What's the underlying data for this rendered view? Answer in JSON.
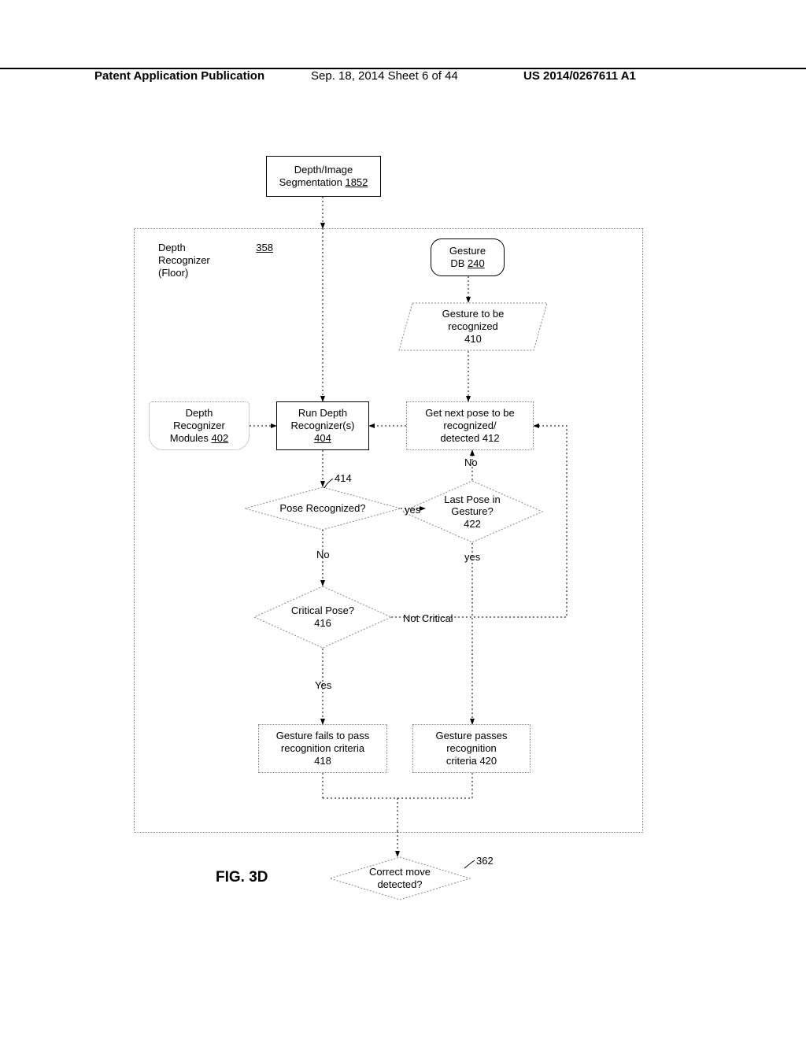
{
  "header": {
    "left": "Patent Application Publication",
    "mid": "Sep. 18, 2014  Sheet 6 of 44",
    "right": "US 2014/0267611 A1"
  },
  "figure_label": "FIG. 3D",
  "blocks": {
    "depth_image_seg": {
      "line1": "Depth/Image",
      "line2": "Segmentation",
      "ref": "1852"
    },
    "depth_recognizer_floor": {
      "line1": "Depth",
      "line2": "Recognizer",
      "line3": "(Floor)",
      "ref": "358"
    },
    "gesture_db": {
      "line1": "Gesture",
      "line2_pre": "DB ",
      "ref": "240"
    },
    "gesture_to_recog": {
      "line1": "Gesture to be",
      "line2": "recognized",
      "ref": "410"
    },
    "depth_recog_modules": {
      "line1": "Depth",
      "line2": "Recognizer",
      "line3_pre": "Modules ",
      "ref": "402"
    },
    "run_depth": {
      "line1": "Run Depth",
      "line2": "Recognizer(s)",
      "ref": "404"
    },
    "get_next_pose": {
      "line1": "Get next pose to be",
      "line2": "recognized/",
      "line3_pre": "detected ",
      "ref": "412"
    },
    "pose_recognized": {
      "text": "Pose Recognized?",
      "ref": "414"
    },
    "last_pose": {
      "line1": "Last Pose in",
      "line2": "Gesture?",
      "ref": "422"
    },
    "critical_pose": {
      "line1": "Critical Pose?",
      "ref": "416"
    },
    "gesture_fail": {
      "line1": "Gesture fails to pass",
      "line2": "recognition criteria",
      "ref": "418"
    },
    "gesture_pass": {
      "line1": "Gesture passes",
      "line2": "recognition",
      "line3_pre": "criteria ",
      "ref": "420"
    },
    "correct_move": {
      "line1": "Correct move",
      "line2": "detected?",
      "ref": "362"
    }
  },
  "labels": {
    "yes1": "yes",
    "no1": "No",
    "no2": "No",
    "yes2": "yes",
    "not_critical": "Not Critical",
    "yes3": "Yes"
  }
}
